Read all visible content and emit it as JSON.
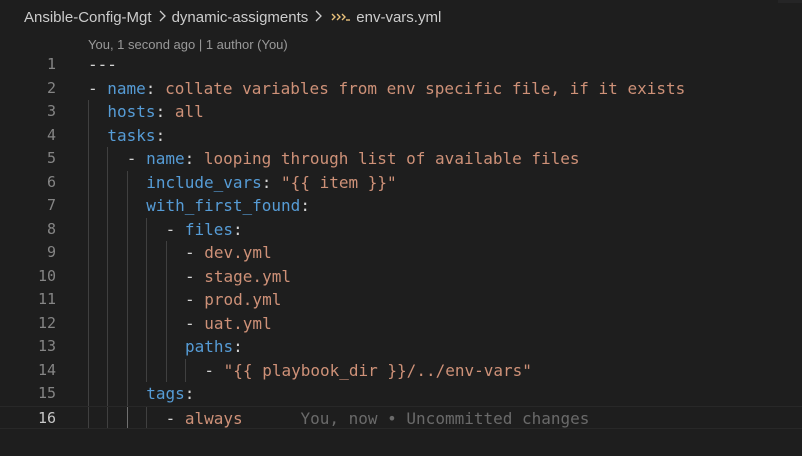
{
  "breadcrumb": {
    "root": "Ansible-Config-Mgt",
    "folder": "dynamic-assigments",
    "file": "env-vars.yml",
    "file_icon": "yml-file-icon"
  },
  "codelens": {
    "text": "You, 1 second ago | 1 author (You)"
  },
  "editor": {
    "active_line": 16,
    "blame_inline": "You, now • Uncommitted changes",
    "lines": [
      {
        "n": "1",
        "indent": 0,
        "segs": [
          {
            "t": "---",
            "c": "p"
          }
        ]
      },
      {
        "n": "2",
        "indent": 0,
        "segs": [
          {
            "t": "- ",
            "c": "p"
          },
          {
            "t": "name",
            "c": "k"
          },
          {
            "t": ": ",
            "c": "p"
          },
          {
            "t": "collate variables from env specific file, if it exists",
            "c": "s"
          }
        ]
      },
      {
        "n": "3",
        "indent": 1,
        "segs": [
          {
            "t": "hosts",
            "c": "k"
          },
          {
            "t": ": ",
            "c": "p"
          },
          {
            "t": "all",
            "c": "s"
          }
        ]
      },
      {
        "n": "4",
        "indent": 1,
        "segs": [
          {
            "t": "tasks",
            "c": "k"
          },
          {
            "t": ":",
            "c": "p"
          }
        ]
      },
      {
        "n": "5",
        "indent": 2,
        "segs": [
          {
            "t": "- ",
            "c": "p"
          },
          {
            "t": "name",
            "c": "k"
          },
          {
            "t": ": ",
            "c": "p"
          },
          {
            "t": "looping through list of available files",
            "c": "s"
          }
        ]
      },
      {
        "n": "6",
        "indent": 3,
        "segs": [
          {
            "t": "include_vars",
            "c": "k"
          },
          {
            "t": ": ",
            "c": "p"
          },
          {
            "t": "\"{{ item }}\"",
            "c": "s"
          }
        ]
      },
      {
        "n": "7",
        "indent": 3,
        "segs": [
          {
            "t": "with_first_found",
            "c": "k"
          },
          {
            "t": ":",
            "c": "p"
          }
        ]
      },
      {
        "n": "8",
        "indent": 4,
        "segs": [
          {
            "t": "- ",
            "c": "p"
          },
          {
            "t": "files",
            "c": "k"
          },
          {
            "t": ":",
            "c": "p"
          }
        ]
      },
      {
        "n": "9",
        "indent": 5,
        "segs": [
          {
            "t": "- ",
            "c": "p"
          },
          {
            "t": "dev.yml",
            "c": "s"
          }
        ]
      },
      {
        "n": "10",
        "indent": 5,
        "segs": [
          {
            "t": "- ",
            "c": "p"
          },
          {
            "t": "stage.yml",
            "c": "s"
          }
        ]
      },
      {
        "n": "11",
        "indent": 5,
        "segs": [
          {
            "t": "- ",
            "c": "p"
          },
          {
            "t": "prod.yml",
            "c": "s"
          }
        ]
      },
      {
        "n": "12",
        "indent": 5,
        "segs": [
          {
            "t": "- ",
            "c": "p"
          },
          {
            "t": "uat.yml",
            "c": "s"
          }
        ]
      },
      {
        "n": "13",
        "indent": 5,
        "segs": [
          {
            "t": "paths",
            "c": "k"
          },
          {
            "t": ":",
            "c": "p"
          }
        ]
      },
      {
        "n": "14",
        "indent": 6,
        "segs": [
          {
            "t": "- ",
            "c": "p"
          },
          {
            "t": "\"{{ playbook_dir }}/../env-vars\"",
            "c": "s"
          }
        ]
      },
      {
        "n": "15",
        "indent": 3,
        "segs": [
          {
            "t": "tags",
            "c": "k"
          },
          {
            "t": ":",
            "c": "p"
          }
        ]
      },
      {
        "n": "16",
        "indent": 4,
        "segs": [
          {
            "t": "- ",
            "c": "p"
          },
          {
            "t": "always",
            "c": "s"
          }
        ]
      }
    ]
  },
  "colors": {
    "background": "#1e1e1e",
    "key": "#569cd6",
    "string": "#ce9178",
    "line_number": "#858585",
    "codelens": "#999999"
  }
}
